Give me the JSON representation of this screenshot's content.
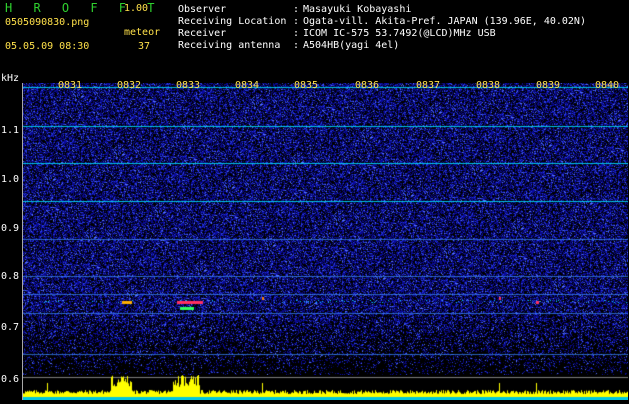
{
  "app": {
    "title": "H R O F F T",
    "version": "1.00"
  },
  "file": {
    "filename": "0505090830.png",
    "datetime": "05.05.09 08:30",
    "mode_label": "meteor",
    "count": "37"
  },
  "info": [
    {
      "label": "Observer",
      "value": "Masayuki Kobayashi"
    },
    {
      "label": "Receiving Location",
      "value": "Ogata-vill. Akita-Pref. JAPAN (139.96E, 40.02N)"
    },
    {
      "label": "Receiver",
      "value": "ICOM IC-575 53.7492(@LCD)MHz USB"
    },
    {
      "label": "Receiving antenna",
      "value": "A504HB(yagi 4el)"
    }
  ],
  "axis": {
    "unit": "kHz",
    "y_ticks": [
      "1.1",
      "1.0",
      "0.9",
      "0.8",
      "0.7",
      "0.6"
    ],
    "time_labels": [
      "0831",
      "0832",
      "0833",
      "0834",
      "0835",
      "0836",
      "0837",
      "0838",
      "0839",
      "0840"
    ]
  },
  "colors": {
    "background": "#000000",
    "noise_dark": "#0a0a6e",
    "noise_bright": "#3a4cff",
    "line_cyan": "#00e5ff",
    "power_yellow": "#ffff00",
    "label_yellow": "#ffe14a",
    "title_green": "#2fd12f"
  }
}
